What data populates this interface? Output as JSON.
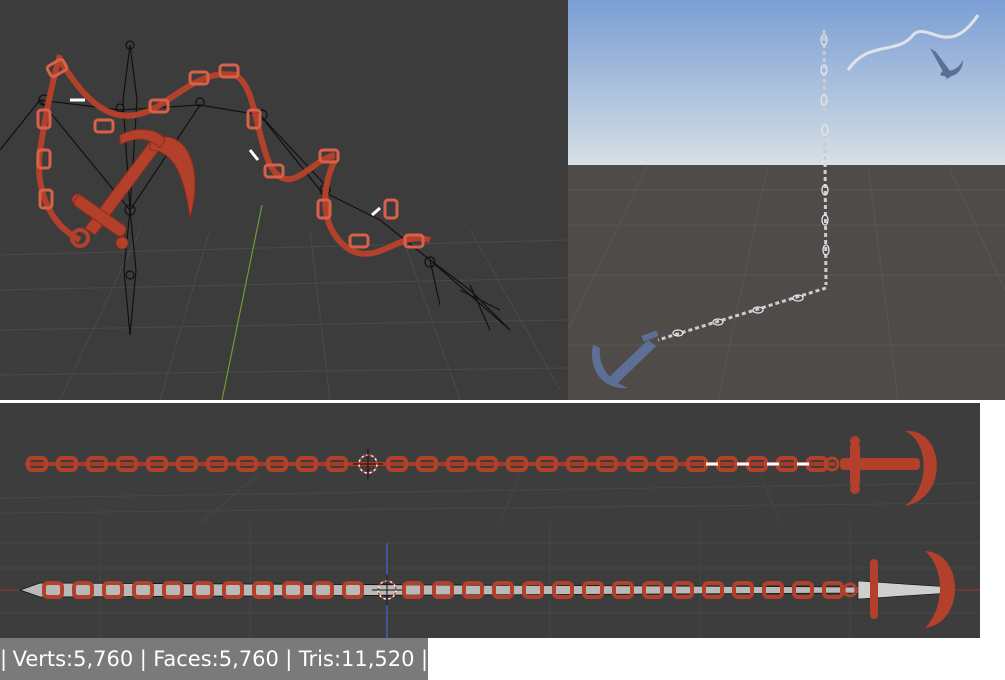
{
  "status_bar": {
    "separator": "|",
    "verts_label": "Verts:5,760",
    "faces_label": "Faces:5,760",
    "tris_label": "Tris:11,520"
  },
  "viewports": {
    "blender_rig_view": {
      "mode": "armature-pose",
      "background": "#3c3c3c"
    },
    "unity_scene_view": {
      "sky_top": "#7b9ed4",
      "sky_horizon": "#c9d6e0",
      "ground": "#4e4b49"
    },
    "blender_top_view": {
      "background": "#3d3d3d"
    },
    "blender_front_view": {
      "background": "#3d3d3d"
    }
  },
  "colors": {
    "chain_red": "#b2402b",
    "chain_red_light": "#d8614a",
    "unity_chain": "#c9cdd3",
    "unity_anchor": "#5e6f96",
    "bone": "#111111",
    "selection": "#ffffff"
  },
  "icons": [
    "3d-cursor-icon",
    "anchor-model",
    "chain-model",
    "armature-bones"
  ]
}
